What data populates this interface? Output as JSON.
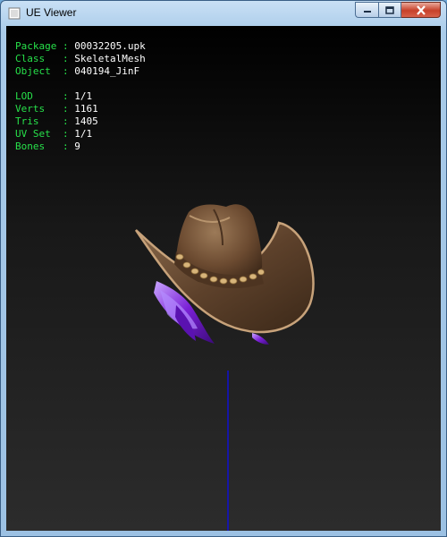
{
  "window": {
    "title": "UE Viewer",
    "controls": [
      "minimize-icon",
      "maximize-icon",
      "close-icon"
    ]
  },
  "info": {
    "group1": [
      {
        "key": "Package",
        "value": "00032205.upk"
      },
      {
        "key": "Class  ",
        "value": "SkeletalMesh"
      },
      {
        "key": "Object ",
        "value": "040194_JinF"
      }
    ],
    "group2": [
      {
        "key": "LOD    ",
        "value": "1/1"
      },
      {
        "key": "Verts  ",
        "value": "1161"
      },
      {
        "key": "Tris   ",
        "value": "1405"
      },
      {
        "key": "UV Set ",
        "value": "1/1"
      },
      {
        "key": "Bones  ",
        "value": "9"
      }
    ]
  },
  "colors": {
    "info_key": "#27e04a",
    "info_value": "#ffffff",
    "hat_brown": "#6b4a30",
    "hat_band": "#c49a5a",
    "feather": "#8a2be2",
    "bone_line": "#1010d0"
  }
}
